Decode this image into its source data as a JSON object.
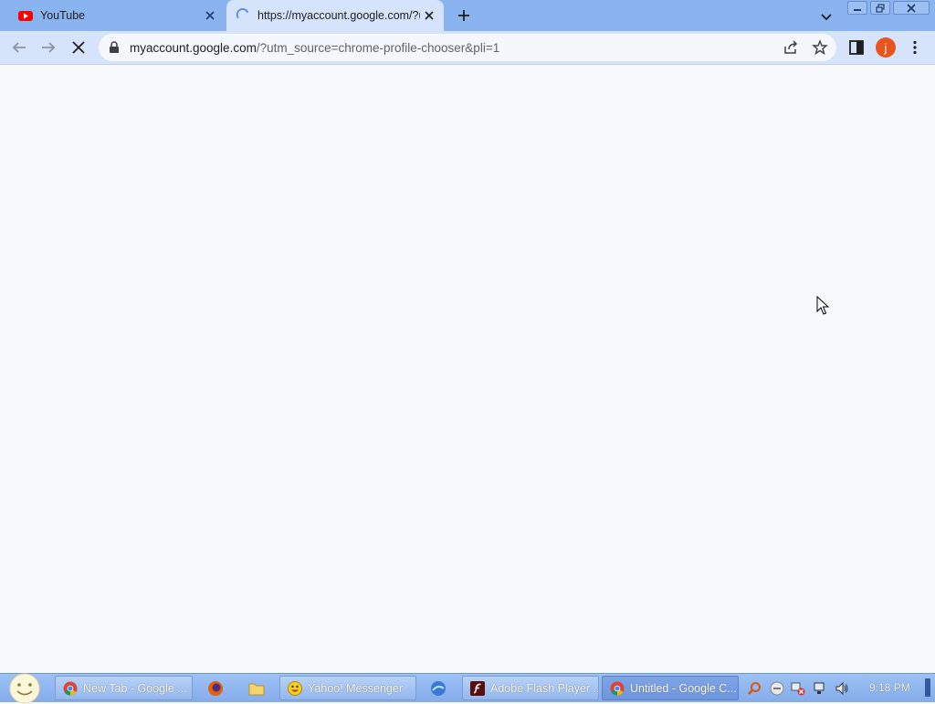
{
  "tabs": [
    {
      "title": "YouTube",
      "favicon": "youtube-icon",
      "active": false
    },
    {
      "title": "https://myaccount.google.com/?utm_source=chrome-profile-chooser&pli=1",
      "favicon": "loading-spinner-icon",
      "active": true
    }
  ],
  "toolbar": {
    "url_host": "myaccount.google.com",
    "url_rest": "/?utm_source=chrome-profile-chooser&pli=1",
    "profile_initial": "j"
  },
  "taskbar": {
    "buttons": [
      {
        "label": "New Tab - Google ...",
        "icon": "chrome-icon"
      },
      {
        "label": "Yahoo! Messenger",
        "icon": "yahoo-messenger-icon"
      },
      {
        "label": "Adobe Flash Player ...",
        "icon": "flash-icon"
      },
      {
        "label": "Untitled - Google C...",
        "icon": "chrome-icon",
        "active": true
      }
    ],
    "clock": "9:18 PM"
  },
  "colors": {
    "tab_strip": "#8ab4f0",
    "toolbar": "#d5e3fb",
    "page_bg": "#f8f9fa",
    "avatar": "#e8541c"
  }
}
